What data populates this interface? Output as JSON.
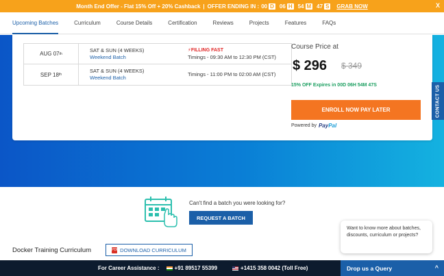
{
  "offer_bar": {
    "text": "Month End Offer - Flat 15% Off + 20% Cashback",
    "sep": "|",
    "ending_label": "OFFER ENDING IN :",
    "countdown": [
      {
        "value": "00",
        "unit": "D"
      },
      {
        "value": "06",
        "unit": "H"
      },
      {
        "value": "54",
        "unit": "M"
      },
      {
        "value": "47",
        "unit": "S"
      }
    ],
    "grab": "GRAB NOW",
    "close": "X"
  },
  "tabs": [
    "Upcoming Batches",
    "Curriculum",
    "Course Details",
    "Certification",
    "Reviews",
    "Projects",
    "Features",
    "FAQs"
  ],
  "batches": [
    {
      "date": "AUG 07",
      "sup": "th",
      "days": "SAT & SUN (4 WEEKS)",
      "type": "Weekend Batch",
      "status": "FILLING FAST",
      "timing": "Timings - 09:30 AM to 12:30 PM (CST)"
    },
    {
      "date": "SEP 18",
      "sup": "th",
      "days": "SAT & SUN (4 WEEKS)",
      "type": "Weekend Batch",
      "status": "",
      "timing": "Timings - 11:00 PM to 02:00 AM (CST)"
    }
  ],
  "pricing": {
    "title": "Course Price at",
    "price": "$ 296",
    "old_price": "$ 349",
    "offer": "15% OFF Expires in 00D 06H 54M 47S",
    "enroll": "ENROLL NOW PAY LATER",
    "powered_by": "Powered by",
    "paypal_a": "Pay",
    "paypal_b": "Pal"
  },
  "contact_tab": "CONTACT US",
  "request": {
    "text": "Can't find a batch you were looking for?",
    "button": "REQUEST A BATCH"
  },
  "chat": "Want to know more about batches, discounts, curriculum or projects?",
  "curriculum": {
    "title": "Docker Training Curriculum",
    "download": "DOWNLOAD CURRICULUM",
    "pdf_label": "PDF"
  },
  "footer": {
    "assist": "For Career Assistance :",
    "phone_in": "+91 89517 55399",
    "phone_us": "+1415 358 0042 (Toll Free)",
    "drop": "Drop us a Query",
    "chevron": "^"
  },
  "colors": {
    "accent": "#1b5fa8",
    "offer": "#f7a21b",
    "enroll": "#f47521"
  }
}
